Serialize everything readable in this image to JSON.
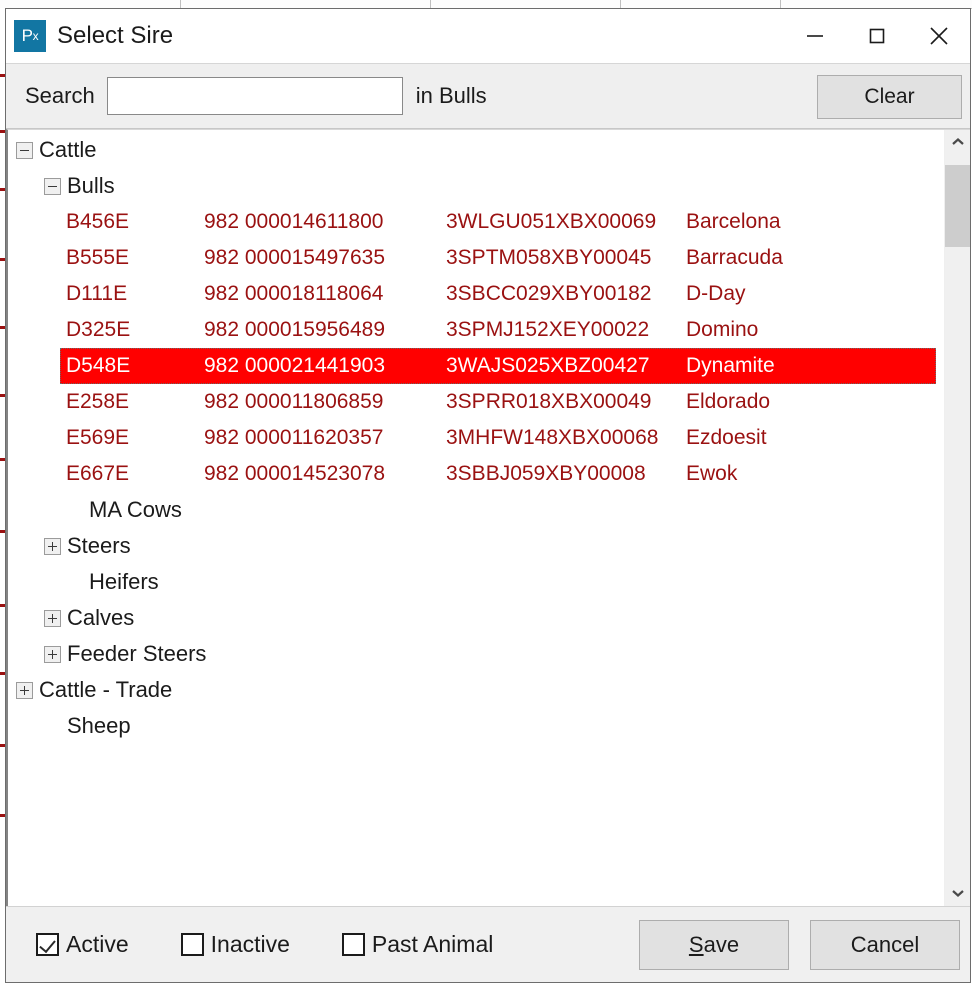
{
  "window": {
    "title": "Select Sire",
    "app_icon_main": "P",
    "app_icon_sub": "x",
    "icon_color": "#1276a3",
    "controls": {
      "minimize": "minimize-icon",
      "maximize": "maximize-icon",
      "close": "close-icon"
    }
  },
  "search": {
    "label": "Search",
    "value": "",
    "placeholder": "",
    "scope": "in Bulls",
    "clear_label": "Clear"
  },
  "tree": {
    "nodes": [
      {
        "label": "Cattle",
        "level": 0,
        "expander": "minus"
      },
      {
        "label": "Bulls",
        "level": 1,
        "expander": "minus"
      }
    ],
    "after_nodes": [
      {
        "label": "MA Cows",
        "level": 2,
        "expander": "none"
      },
      {
        "label": "Steers",
        "level": 1,
        "expander": "plus"
      },
      {
        "label": "Heifers",
        "level": 2,
        "expander": "none"
      },
      {
        "label": "Calves",
        "level": 1,
        "expander": "plus"
      },
      {
        "label": "Feeder Steers",
        "level": 1,
        "expander": "plus"
      },
      {
        "label": "Cattle - Trade",
        "level": 0,
        "expander": "plus"
      },
      {
        "label": "Sheep",
        "level": 1,
        "expander": "none"
      }
    ]
  },
  "animals": {
    "columns": [
      "tag",
      "eid",
      "registration",
      "name"
    ],
    "text_color": "#9a1111",
    "selected_bg": "#ff0000",
    "selected_fg": "#ffffff",
    "rows": [
      {
        "tag": "B456E",
        "eid": "982 000014611800",
        "registration": "3WLGU051XBX00069",
        "name": "Barcelona",
        "selected": false
      },
      {
        "tag": "B555E",
        "eid": "982 000015497635",
        "registration": "3SPTM058XBY00045",
        "name": "Barracuda",
        "selected": false
      },
      {
        "tag": "D111E",
        "eid": "982 000018118064",
        "registration": "3SBCC029XBY00182",
        "name": "D-Day",
        "selected": false
      },
      {
        "tag": "D325E",
        "eid": "982 000015956489",
        "registration": "3SPMJ152XEY00022",
        "name": "Domino",
        "selected": false
      },
      {
        "tag": "D548E",
        "eid": "982 000021441903",
        "registration": "3WAJS025XBZ00427",
        "name": "Dynamite",
        "selected": true
      },
      {
        "tag": "E258E",
        "eid": "982 000011806859",
        "registration": "3SPRR018XBX00049",
        "name": "Eldorado",
        "selected": false
      },
      {
        "tag": "E569E",
        "eid": "982 000011620357",
        "registration": "3MHFW148XBX00068",
        "name": "Ezdoesit",
        "selected": false
      },
      {
        "tag": "E667E",
        "eid": "982 000014523078",
        "registration": "3SBBJ059XBY00008",
        "name": "Ewok",
        "selected": false
      }
    ]
  },
  "scrollbar": {
    "up_icon": "chevron-up-icon",
    "down_icon": "chevron-down-icon"
  },
  "footer": {
    "checkboxes": [
      {
        "label": "Active",
        "checked": true
      },
      {
        "label": "Inactive",
        "checked": false
      },
      {
        "label": "Past Animal",
        "checked": false
      }
    ],
    "save_label": "Save",
    "save_accel": "S",
    "save_rest": "ave",
    "cancel_label": "Cancel"
  },
  "background": {
    "glimpse": [
      "",
      "",
      "",
      ""
    ]
  }
}
